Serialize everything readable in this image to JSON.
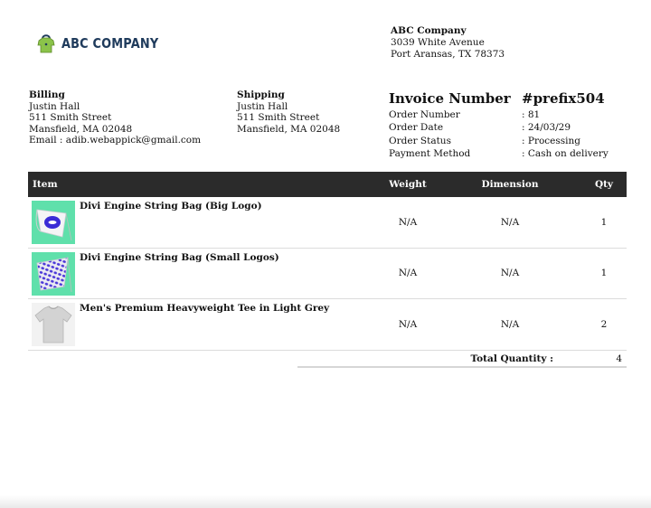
{
  "brand": {
    "logo_text": "ABC COMPANY",
    "logo_color": "#1f3b5c",
    "accent_green": "#8bc34a"
  },
  "company": {
    "name": "ABC Company",
    "street": "3039 White Avenue",
    "city": "Port Aransas, TX 78373"
  },
  "billing": {
    "heading": "Billing",
    "name": "Justin Hall",
    "street": "511 Smith Street",
    "city": "Mansfield, MA 02048",
    "email": "Email : adib.webappick@gmail.com"
  },
  "shipping": {
    "heading": "Shipping",
    "name": "Justin Hall",
    "street": "511 Smith Street",
    "city": "Mansfield, MA 02048"
  },
  "invoice": {
    "number_label": "Invoice Number",
    "number_value": "#prefix504",
    "meta": [
      {
        "label": "Order Number",
        "value": ": 81"
      },
      {
        "label": "Order Date",
        "value": ": 24/03/29"
      },
      {
        "label": "Order Status",
        "value": ": Processing"
      },
      {
        "label": "Payment Method",
        "value": ": Cash on delivery"
      }
    ]
  },
  "table": {
    "headers": {
      "item": "Item",
      "weight": "Weight",
      "dimension": "Dimension",
      "qty": "Qty"
    },
    "rows": [
      {
        "name": "Divi Engine String Bag (Big Logo)",
        "weight": "N/A",
        "dimension": "N/A",
        "qty": "1",
        "image": "string-bag-big-logo"
      },
      {
        "name": "Divi Engine String Bag (Small Logos)",
        "weight": "N/A",
        "dimension": "N/A",
        "qty": "1",
        "image": "string-bag-small-logos"
      },
      {
        "name": "Men's Premium Heavyweight Tee in Light Grey",
        "weight": "N/A",
        "dimension": "N/A",
        "qty": "2",
        "image": "grey-tee"
      }
    ],
    "total_label": "Total Quantity :",
    "total_value": "4"
  }
}
